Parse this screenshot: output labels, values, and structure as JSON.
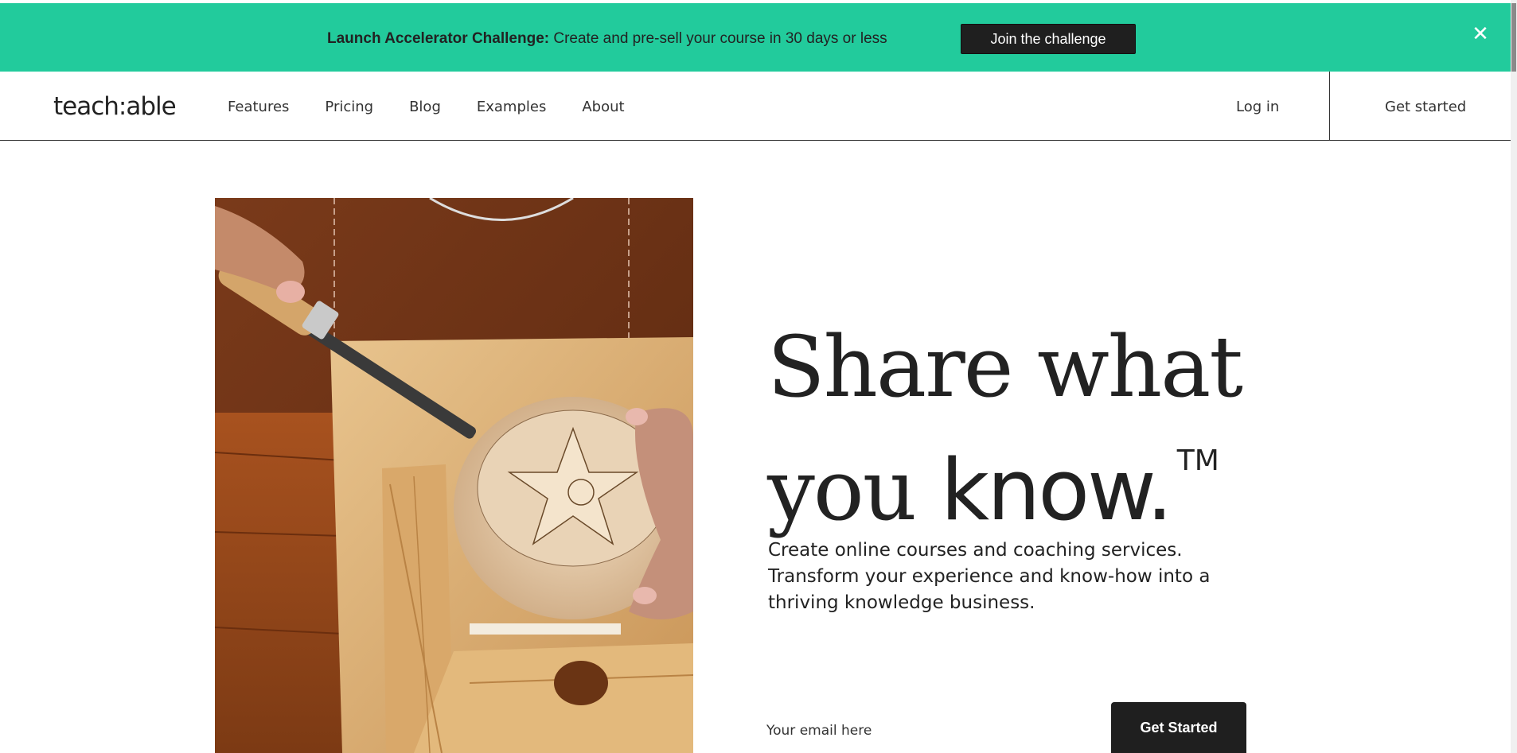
{
  "banner": {
    "title": "Launch Accelerator Challenge:",
    "text": "Create and pre-sell your course in 30 days or less",
    "button_label": "Join the challenge",
    "close_glyph": "✕",
    "background_color": "#22cb9c"
  },
  "nav": {
    "logo": "teach:able",
    "links": [
      "Features",
      "Pricing",
      "Blog",
      "Examples",
      "About"
    ],
    "login_label": "Log in",
    "get_started_label": "Get started"
  },
  "hero": {
    "headline_line1": "Share what",
    "headline_line2_a": "you",
    "headline_line2_b": "know.",
    "trademark": "TM",
    "subtext": "Create online courses and coaching services. Transform your experience and know-how into a thriving knowledge business.",
    "email_placeholder": "Your email here",
    "cta_label": "Get Started",
    "image_subject": "wood-carving-photo"
  }
}
